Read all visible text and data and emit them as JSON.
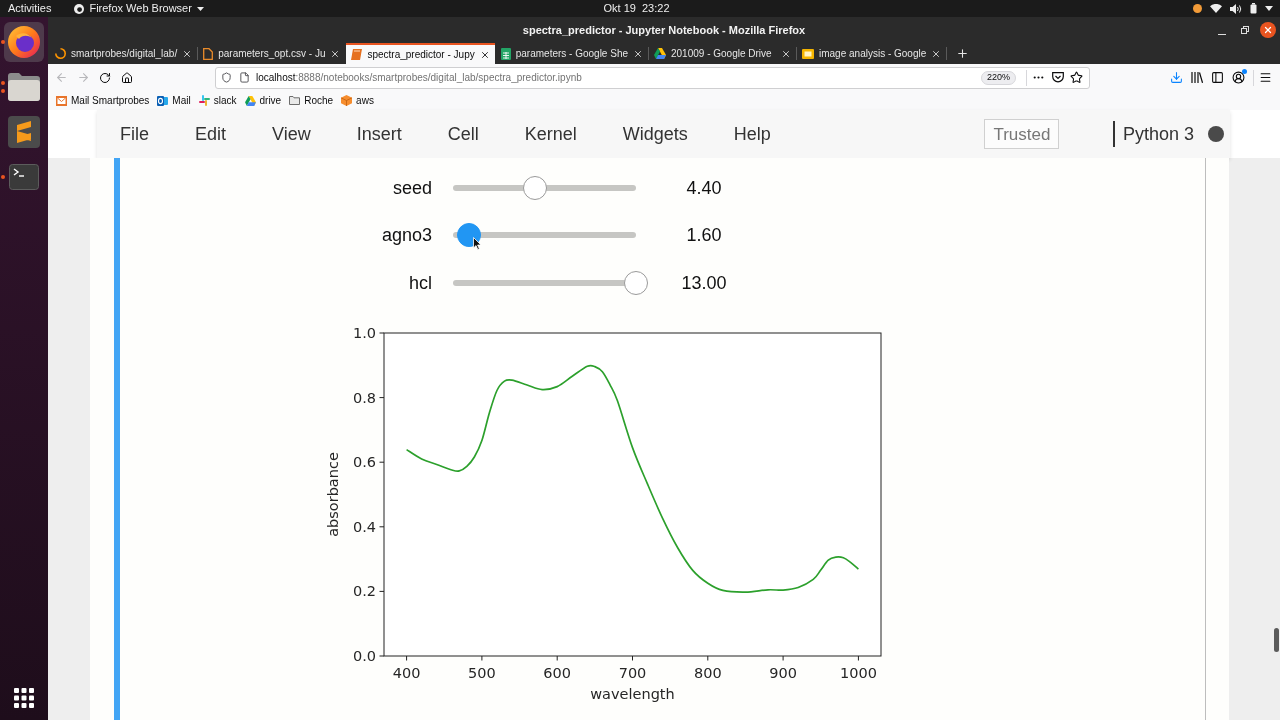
{
  "top_bar": {
    "activities": "Activities",
    "app_menu": "Firefox Web Browser",
    "clock": "Okt 19  23:22"
  },
  "dock": [
    {
      "kind": "firefox",
      "selected": true,
      "running": true,
      "multiple_windows": false
    },
    {
      "kind": "files",
      "selected": false,
      "running": true,
      "multiple_windows": true
    },
    {
      "kind": "sublime",
      "selected": false,
      "running": false,
      "multiple_windows": false
    },
    {
      "kind": "terminal",
      "selected": false,
      "running": true,
      "multiple_windows": false
    }
  ],
  "window": {
    "title": "spectra_predictor - Jupyter Notebook - Mozilla Firefox"
  },
  "tabs": [
    {
      "label": "smartprobes/digital_lab/",
      "kind": "loading",
      "selected": false
    },
    {
      "label": "parameters_opt.csv - Ju",
      "kind": "document",
      "selected": false
    },
    {
      "label": "spectra_predictor - Jupy",
      "kind": "notebook",
      "selected": true
    },
    {
      "label": "parameters - Google She",
      "kind": "spreadsheet",
      "selected": false
    },
    {
      "label": "201009 - Google Drive",
      "kind": "drive",
      "selected": false
    },
    {
      "label": "image analysis - Google",
      "kind": "presentation",
      "selected": false
    }
  ],
  "toolbar": {
    "back_disabled": true,
    "forward_disabled": true,
    "url_host": "localhost",
    "url_path": ":8888/notebooks/smartprobes/digital_lab/spectra_predictor.ipynb",
    "zoom": "220%"
  },
  "bookmarks": [
    {
      "label": "Mail Smartprobes",
      "kind": "mail"
    },
    {
      "label": "Mail",
      "kind": "outlook"
    },
    {
      "label": "slack",
      "kind": "slack"
    },
    {
      "label": "drive",
      "kind": "drive"
    },
    {
      "label": "Roche",
      "kind": "folder"
    },
    {
      "label": "aws",
      "kind": "aws"
    }
  ],
  "notebook": {
    "menu": [
      "File",
      "Edit",
      "View",
      "Insert",
      "Cell",
      "Kernel",
      "Widgets",
      "Help"
    ],
    "trusted": "Trusted",
    "kernel": {
      "name": "Python 3",
      "busy": true
    },
    "sliders": [
      {
        "label": "seed",
        "level": 0.45,
        "value": "4.40",
        "active": false
      },
      {
        "label": "agno3",
        "level": 0.09,
        "value": "1.60",
        "active": true
      },
      {
        "label": "hcl",
        "level": 1,
        "value": "13.00",
        "active": false
      }
    ],
    "plot": {
      "chart_data": {
        "type": "line",
        "xlabel": "wavelength",
        "ylabel": "absorbance",
        "x": [
          400,
          420,
          440,
          460,
          470,
          480,
          490,
          500,
          510,
          520,
          530,
          540,
          560,
          580,
          600,
          620,
          640,
          650,
          660,
          670,
          680,
          700,
          720,
          740,
          760,
          780,
          800,
          820,
          850,
          880,
          900,
          920,
          940,
          950,
          960,
          970,
          980,
          990,
          1000
        ],
        "series": [
          {
            "color": "#2ca02c",
            "values": [
              0.639,
              0.61,
              0.593,
              0.576,
              0.573,
              0.587,
              0.616,
              0.667,
              0.753,
              0.822,
              0.851,
              0.854,
              0.839,
              0.825,
              0.834,
              0.866,
              0.897,
              0.896,
              0.88,
              0.84,
              0.79,
              0.645,
              0.532,
              0.426,
              0.335,
              0.265,
              0.225,
              0.203,
              0.198,
              0.205,
              0.204,
              0.212,
              0.237,
              0.266,
              0.297,
              0.306,
              0.304,
              0.289,
              0.269
            ]
          }
        ],
        "xlim": [
          370,
          1030
        ],
        "ylim": [
          0,
          1
        ],
        "xticks": [
          400,
          500,
          600,
          700,
          800,
          900,
          1000
        ],
        "yticks": [
          {
            "value": 0,
            "label": "0.0"
          },
          {
            "value": 0.2,
            "label": "0.2"
          },
          {
            "value": 0.4,
            "label": "0.4"
          },
          {
            "value": 0.6,
            "label": "0.6"
          },
          {
            "value": 0.8,
            "label": "0.8"
          },
          {
            "value": 1,
            "label": "1.0"
          }
        ]
      }
    }
  }
}
